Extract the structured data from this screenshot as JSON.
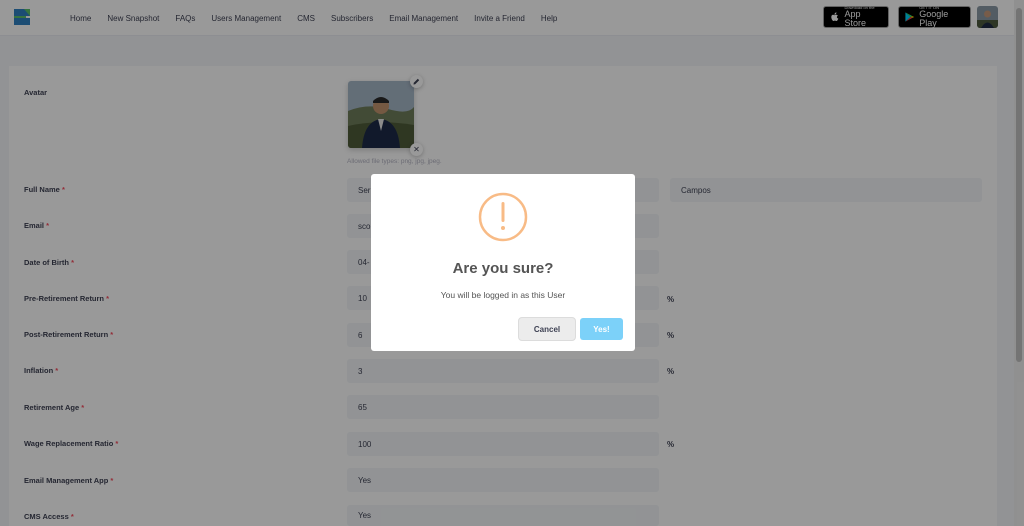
{
  "nav": {
    "items": [
      "Home",
      "New Snapshot",
      "FAQs",
      "Users Management",
      "CMS",
      "Subscribers",
      "Email Management",
      "Invite a Friend",
      "Help"
    ],
    "appstore_small": "Download on the",
    "appstore_big": "App Store",
    "googleplay_small": "GET IT ON",
    "googleplay_big": "Google Play"
  },
  "form": {
    "avatar_label": "Avatar",
    "avatar_hint": "Allowed file types: png, jpg, jpeg.",
    "remove_glyph": "✕",
    "rows": [
      {
        "label": "Full Name",
        "values": [
          "Ser",
          "Campos"
        ]
      },
      {
        "label": "Email",
        "values": [
          "sco"
        ]
      },
      {
        "label": "Date of Birth",
        "values": [
          "04-"
        ]
      },
      {
        "label": "Pre-Retirement Return",
        "values": [
          "10"
        ],
        "suffix": "%"
      },
      {
        "label": "Post-Retirement Return",
        "values": [
          "6"
        ],
        "suffix": "%"
      },
      {
        "label": "Inflation",
        "values": [
          "3"
        ],
        "suffix": "%"
      },
      {
        "label": "Retirement Age",
        "values": [
          "65"
        ]
      },
      {
        "label": "Wage Replacement Ratio",
        "values": [
          "100"
        ],
        "suffix": "%"
      },
      {
        "label": "Email Management App",
        "values": [
          "Yes"
        ]
      },
      {
        "label": "CMS Access",
        "values": [
          "Yes"
        ]
      }
    ],
    "required_mark": "*"
  },
  "modal": {
    "title": "Are you sure?",
    "text": "You will be logged in as this User",
    "cancel_label": "Cancel",
    "confirm_label": "Yes!",
    "icon": "warning-icon"
  },
  "colors": {
    "warning": "#f8bb86",
    "confirm": "#7cd1f9",
    "required": "#f64e60"
  }
}
